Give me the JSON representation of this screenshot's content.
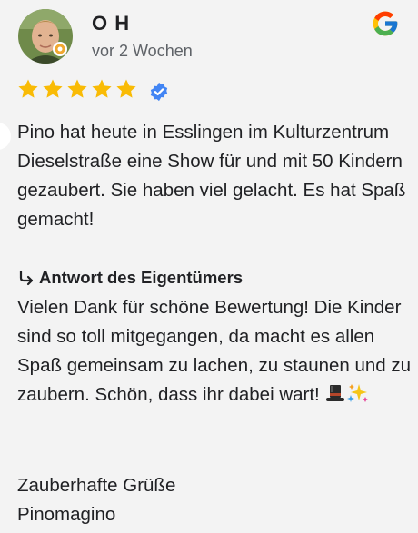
{
  "review": {
    "author_name": "O H",
    "date": "vor 2 Wochen",
    "rating": 5,
    "rating_max": 5,
    "text": "Pino hat heute in Esslingen im Kulturzentrum Dieselstraße eine Show für und mit 50 Kindern gezaubert. Sie haben viel gelacht. Es hat Spaß gemacht!"
  },
  "reply": {
    "header": "Antwort des Eigentümers",
    "text": "Vielen Dank für schöne Bewertung! Die Kinder sind so toll mitgegangen, da macht es allen Spaß gemeinsam zu lachen, zu staunen und zu zaubern. Schön, dass ihr dabei wart!",
    "emojis": [
      "top-hat-emoji",
      "sparkles-emoji"
    ],
    "signoff_line1": "Zauberhafte Grüße",
    "signoff_line2": "Pinomagino"
  },
  "icons": {
    "brand": "google-icon",
    "verified": "verified-badge-icon",
    "reply": "reply-arrow-icon",
    "star": "star-icon"
  },
  "colors": {
    "star": "#F9BB05",
    "verified": "#4285F4",
    "text": "#202124",
    "muted": "#5f6368",
    "background": "#f3f3f3"
  }
}
